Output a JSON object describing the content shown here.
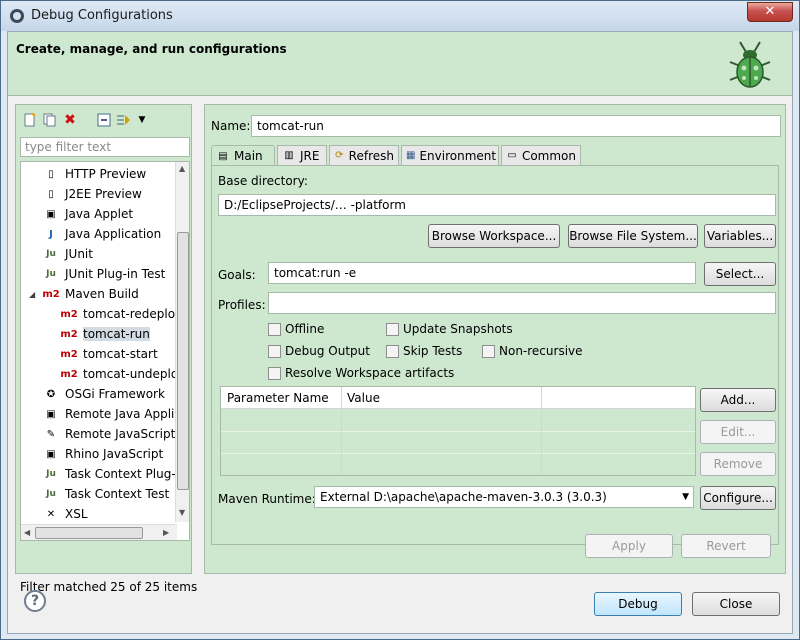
{
  "window": {
    "title": "Debug Configurations",
    "close_glyph": "✕"
  },
  "banner": {
    "heading": "Create, manage, and run configurations"
  },
  "left": {
    "filter_placeholder": "type filter text",
    "tree": [
      {
        "label": "HTTP Preview",
        "icon": "http-preview-icon",
        "glyph": "▯"
      },
      {
        "label": "J2EE Preview",
        "icon": "j2ee-preview-icon",
        "glyph": "▯"
      },
      {
        "label": "Java Applet",
        "icon": "java-applet-icon",
        "glyph": "▣"
      },
      {
        "label": "Java Application",
        "icon": "java-application-icon",
        "glyph": "J"
      },
      {
        "label": "JUnit",
        "icon": "junit-icon",
        "glyph": "Ju"
      },
      {
        "label": "JUnit Plug-in Test",
        "icon": "junit-plugin-icon",
        "glyph": "Ju"
      },
      {
        "label": "Maven Build",
        "icon": "maven-icon",
        "glyph": "m2"
      },
      {
        "label": "tomcat-redeplo",
        "icon": "maven-config-icon",
        "glyph": "m2"
      },
      {
        "label": "tomcat-run",
        "icon": "maven-config-icon",
        "glyph": "m2"
      },
      {
        "label": "tomcat-start",
        "icon": "maven-config-icon",
        "glyph": "m2"
      },
      {
        "label": "tomcat-undeplo",
        "icon": "maven-config-icon",
        "glyph": "m2"
      },
      {
        "label": "OSGi Framework",
        "icon": "osgi-icon",
        "glyph": "✪"
      },
      {
        "label": "Remote Java Appli",
        "icon": "remote-java-icon",
        "glyph": "▣"
      },
      {
        "label": "Remote JavaScript",
        "icon": "remote-javascript-icon",
        "glyph": "✎"
      },
      {
        "label": "Rhino JavaScript",
        "icon": "rhino-icon",
        "glyph": "▣"
      },
      {
        "label": "Task Context Plug-",
        "icon": "task-context-plugin-icon",
        "glyph": "Ju"
      },
      {
        "label": "Task Context Test",
        "icon": "task-context-test-icon",
        "glyph": "Ju"
      },
      {
        "label": "XSL",
        "icon": "xsl-icon",
        "glyph": "✕"
      }
    ],
    "status": "Filter matched 25 of 25 items"
  },
  "config": {
    "name_label": "Name:",
    "name_value": "tomcat-run",
    "tabs": [
      {
        "label": "Main",
        "glyph": "▤"
      },
      {
        "label": "JRE",
        "glyph": "▥"
      },
      {
        "label": "Refresh",
        "glyph": "⟳"
      },
      {
        "label": "Environment",
        "glyph": "▦"
      },
      {
        "label": "Common",
        "glyph": "▭"
      }
    ],
    "base_dir_label": "Base directory:",
    "base_dir_value": "D:/EclipseProjects/…                    -platform",
    "browse_workspace": "Browse Workspace...",
    "browse_fs": "Browse File System...",
    "variables": "Variables...",
    "goals_label": "Goals:",
    "goals_value": "tomcat:run -e",
    "select": "Select...",
    "profiles_label": "Profiles:",
    "profiles_value": "",
    "checks": {
      "offline": "Offline",
      "update_snapshots": "Update Snapshots",
      "debug_output": "Debug Output",
      "skip_tests": "Skip Tests",
      "non_recursive": "Non-recursive",
      "resolve_workspace": "Resolve Workspace artifacts"
    },
    "params": {
      "col_name": "Parameter Name",
      "col_value": "Value"
    },
    "add": "Add...",
    "edit": "Edit...",
    "remove": "Remove",
    "runtime_label": "Maven Runtime:",
    "runtime_value": "External D:\\apache\\apache-maven-3.0.3 (3.0.3)",
    "configure": "Configure...",
    "apply": "Apply",
    "revert": "Revert"
  },
  "footer": {
    "help": "?",
    "debug": "Debug",
    "close": "Close"
  }
}
